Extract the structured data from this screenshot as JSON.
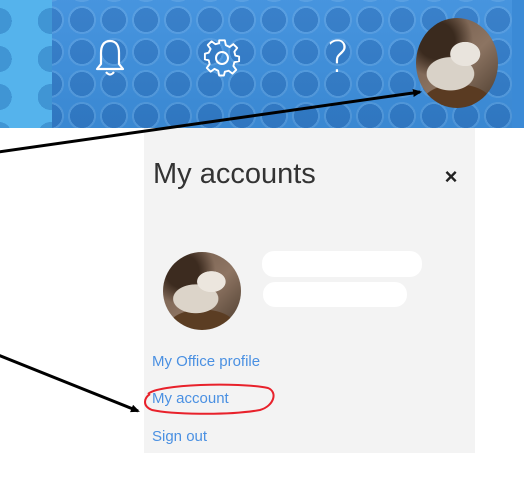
{
  "header": {
    "notifications_icon": "bell-icon",
    "settings_icon": "gear-icon",
    "help_label": "?",
    "avatar_icon": "profile-photo"
  },
  "panel": {
    "title": "My accounts",
    "close_label": "×",
    "links": {
      "office_profile": "My Office profile",
      "my_account": "My account",
      "sign_out": "Sign out"
    }
  },
  "colors": {
    "header_blue": "#3d8fdd",
    "panel_bg": "#f3f3f3",
    "link_blue": "#4a90e2",
    "annotation_red": "#e8212b",
    "annotation_arrow": "#000000"
  }
}
